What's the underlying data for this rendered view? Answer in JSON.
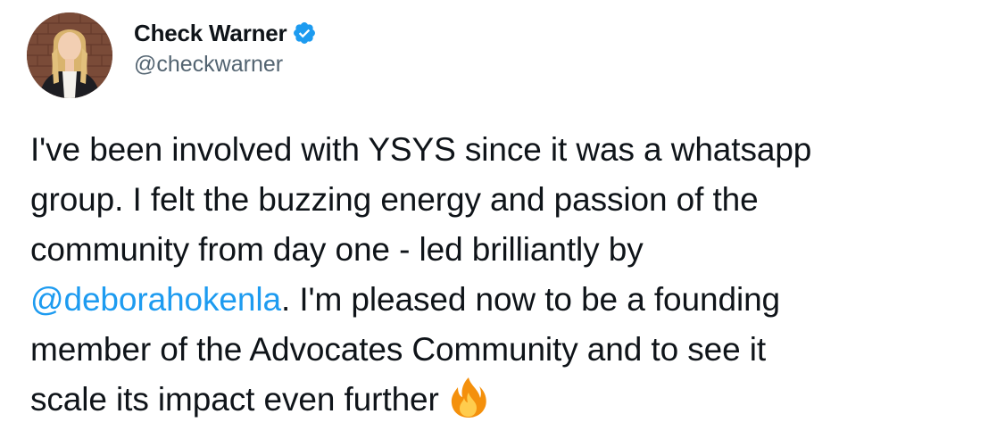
{
  "author": {
    "display_name": "Check Warner",
    "handle": "@checkwarner",
    "verified": true,
    "verified_icon": "verified-badge-icon",
    "avatar_icon": "avatar-photo"
  },
  "tweet": {
    "line1": "I've been involved with YSYS since it was a whatsapp",
    "line2": "group. I felt the buzzing energy and passion of the",
    "line3": "community from day one - led brilliantly by",
    "mention": "@deborahokenla",
    "line4_rest": ". I'm pleased now to be a founding",
    "line5": "member of the Advocates Community and to see it",
    "line6": "scale its impact even further",
    "emoji": "fire-emoji-icon"
  },
  "colors": {
    "text": "#0f1419",
    "secondary": "#536471",
    "link": "#1d9bf0",
    "verified": "#1d9bf0",
    "background": "#ffffff"
  }
}
